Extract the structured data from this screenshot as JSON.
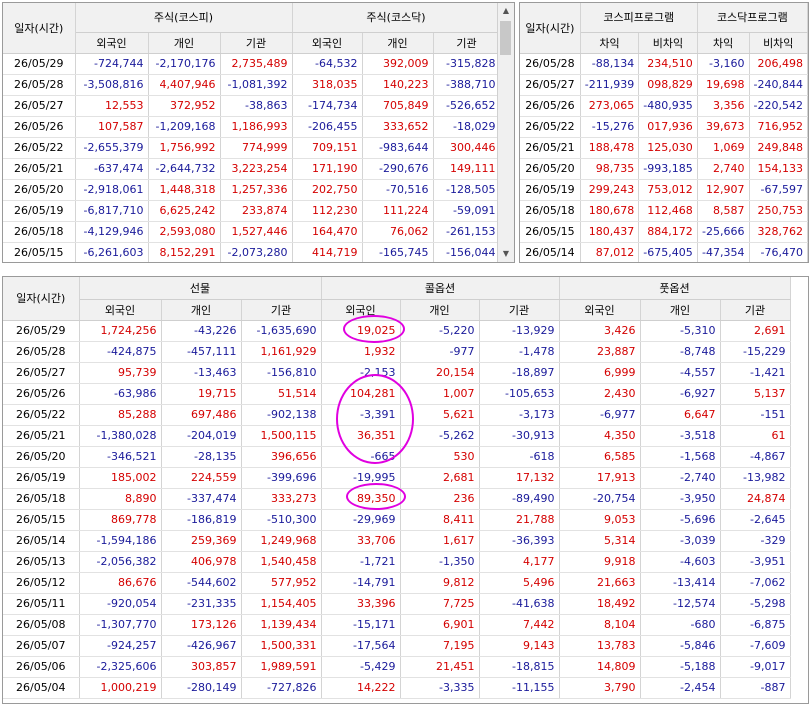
{
  "stock_panel": {
    "date_header": "일자(시간)",
    "group_headers": [
      "주식(코스피)",
      "주식(코스닥)"
    ],
    "sub_headers": [
      "외국인",
      "개인",
      "기관",
      "외국인",
      "개인",
      "기관"
    ],
    "rows": [
      [
        "26/05/29",
        "-724,744",
        "-2,170,176",
        "2,735,489",
        "-64,532",
        "392,009",
        "-315,828"
      ],
      [
        "26/05/28",
        "-3,508,816",
        "4,407,946",
        "-1,081,392",
        "318,035",
        "140,223",
        "-388,710"
      ],
      [
        "26/05/27",
        "12,553",
        "372,952",
        "-38,863",
        "-174,734",
        "705,849",
        "-526,652"
      ],
      [
        "26/05/26",
        "107,587",
        "-1,209,168",
        "1,186,993",
        "-206,455",
        "333,652",
        "-18,029"
      ],
      [
        "26/05/22",
        "-2,655,379",
        "1,756,992",
        "774,999",
        "709,151",
        "-983,644",
        "300,446"
      ],
      [
        "26/05/21",
        "-637,474",
        "-2,644,732",
        "3,223,254",
        "171,190",
        "-290,676",
        "149,111"
      ],
      [
        "26/05/20",
        "-2,918,061",
        "1,448,318",
        "1,257,336",
        "202,750",
        "-70,516",
        "-128,505"
      ],
      [
        "26/05/19",
        "-6,817,710",
        "6,625,242",
        "233,874",
        "112,230",
        "111,224",
        "-59,091"
      ],
      [
        "26/05/18",
        "-4,129,946",
        "2,593,080",
        "1,527,446",
        "164,470",
        "76,062",
        "-261,153"
      ],
      [
        "26/05/15",
        "-6,261,603",
        "8,152,291",
        "-2,073,280",
        "414,719",
        "-165,745",
        "-156,044"
      ]
    ]
  },
  "program_panel": {
    "date_header": "일자(시간)",
    "group_headers": [
      "코스피프로그램",
      "코스닥프로그램"
    ],
    "sub_headers": [
      "차익",
      "비차익",
      "차익",
      "비차익"
    ],
    "rows": [
      [
        "26/05/28",
        "-88,134",
        "234,510",
        "-3,160",
        "206,498"
      ],
      [
        "26/05/27",
        "-211,939",
        "098,829",
        "19,698",
        "-240,844"
      ],
      [
        "26/05/26",
        "273,065",
        "-480,935",
        "3,356",
        "-220,542"
      ],
      [
        "26/05/22",
        "-15,276",
        "017,936",
        "39,673",
        "716,952"
      ],
      [
        "26/05/21",
        "188,478",
        "125,030",
        "1,069",
        "249,848"
      ],
      [
        "26/05/20",
        "98,735",
        "-993,185",
        "2,740",
        "154,133"
      ],
      [
        "26/05/19",
        "299,243",
        "753,012",
        "12,907",
        "-67,597"
      ],
      [
        "26/05/18",
        "180,678",
        "112,468",
        "8,587",
        "250,753"
      ],
      [
        "26/05/15",
        "180,437",
        "884,172",
        "-25,666",
        "328,762"
      ],
      [
        "26/05/14",
        "87,012",
        "-675,405",
        "-47,354",
        "-76,470"
      ]
    ]
  },
  "derivatives_panel": {
    "date_header": "일자(시간)",
    "group_headers": [
      "선물",
      "콜옵션",
      "풋옵션"
    ],
    "sub_headers": [
      "외국인",
      "개인",
      "기관",
      "외국인",
      "개인",
      "기관",
      "외국인",
      "개인",
      "기관"
    ],
    "rows": [
      [
        "26/05/29",
        "1,724,256",
        "-43,226",
        "-1,635,690",
        "19,025",
        "-5,220",
        "-13,929",
        "3,426",
        "-5,310",
        "2,691"
      ],
      [
        "26/05/28",
        "-424,875",
        "-457,111",
        "1,161,929",
        "1,932",
        "-977",
        "-1,478",
        "23,887",
        "-8,748",
        "-15,229"
      ],
      [
        "26/05/27",
        "95,739",
        "-13,463",
        "-156,810",
        "-2,153",
        "20,154",
        "-18,897",
        "6,999",
        "-4,557",
        "-1,421"
      ],
      [
        "26/05/26",
        "-63,986",
        "19,715",
        "51,514",
        "104,281",
        "1,007",
        "-105,653",
        "2,430",
        "-6,927",
        "5,137"
      ],
      [
        "26/05/22",
        "85,288",
        "697,486",
        "-902,138",
        "-3,391",
        "5,621",
        "-3,173",
        "-6,977",
        "6,647",
        "-151"
      ],
      [
        "26/05/21",
        "-1,380,028",
        "-204,019",
        "1,500,115",
        "36,351",
        "-5,262",
        "-30,913",
        "4,350",
        "-3,518",
        "61"
      ],
      [
        "26/05/20",
        "-346,521",
        "-28,135",
        "396,656",
        "-665",
        "530",
        "-618",
        "6,585",
        "-1,568",
        "-4,867"
      ],
      [
        "26/05/19",
        "185,002",
        "224,559",
        "-399,696",
        "-19,995",
        "2,681",
        "17,132",
        "17,913",
        "-2,740",
        "-13,982"
      ],
      [
        "26/05/18",
        "8,890",
        "-337,474",
        "333,273",
        "89,350",
        "236",
        "-89,490",
        "-20,754",
        "-3,950",
        "24,874"
      ],
      [
        "26/05/15",
        "869,778",
        "-186,819",
        "-510,300",
        "-29,969",
        "8,411",
        "21,788",
        "9,053",
        "-5,696",
        "-2,645"
      ],
      [
        "26/05/14",
        "-1,594,186",
        "259,369",
        "1,249,968",
        "33,706",
        "1,617",
        "-36,393",
        "5,314",
        "-3,039",
        "-329"
      ],
      [
        "26/05/13",
        "-2,056,382",
        "406,978",
        "1,540,458",
        "-1,721",
        "-1,350",
        "4,177",
        "9,918",
        "-4,603",
        "-3,951"
      ],
      [
        "26/05/12",
        "86,676",
        "-544,602",
        "577,952",
        "-14,791",
        "9,812",
        "5,496",
        "21,663",
        "-13,414",
        "-7,062"
      ],
      [
        "26/05/11",
        "-920,054",
        "-231,335",
        "1,154,405",
        "33,396",
        "7,725",
        "-41,638",
        "18,492",
        "-12,574",
        "-5,298"
      ],
      [
        "26/05/08",
        "-1,307,770",
        "173,126",
        "1,139,434",
        "-15,171",
        "6,901",
        "7,442",
        "8,104",
        "-680",
        "-6,875"
      ],
      [
        "26/05/07",
        "-924,257",
        "-426,967",
        "1,500,331",
        "-17,564",
        "7,195",
        "9,143",
        "13,783",
        "-5,846",
        "-7,609"
      ],
      [
        "26/05/06",
        "-2,325,606",
        "303,857",
        "1,989,591",
        "-5,429",
        "21,451",
        "-18,815",
        "14,809",
        "-5,188",
        "-9,017"
      ],
      [
        "26/05/04",
        "1,000,219",
        "-280,149",
        "-727,826",
        "14,222",
        "-3,335",
        "-11,155",
        "3,790",
        "-2,454",
        "-887"
      ]
    ]
  },
  "colors": {
    "positive": "#d40000",
    "negative": "#1a1a9a",
    "highlight_circle": "#e000e0"
  },
  "icons": {
    "scroll_up": "triangle-up-icon",
    "scroll_down": "triangle-down-icon"
  }
}
